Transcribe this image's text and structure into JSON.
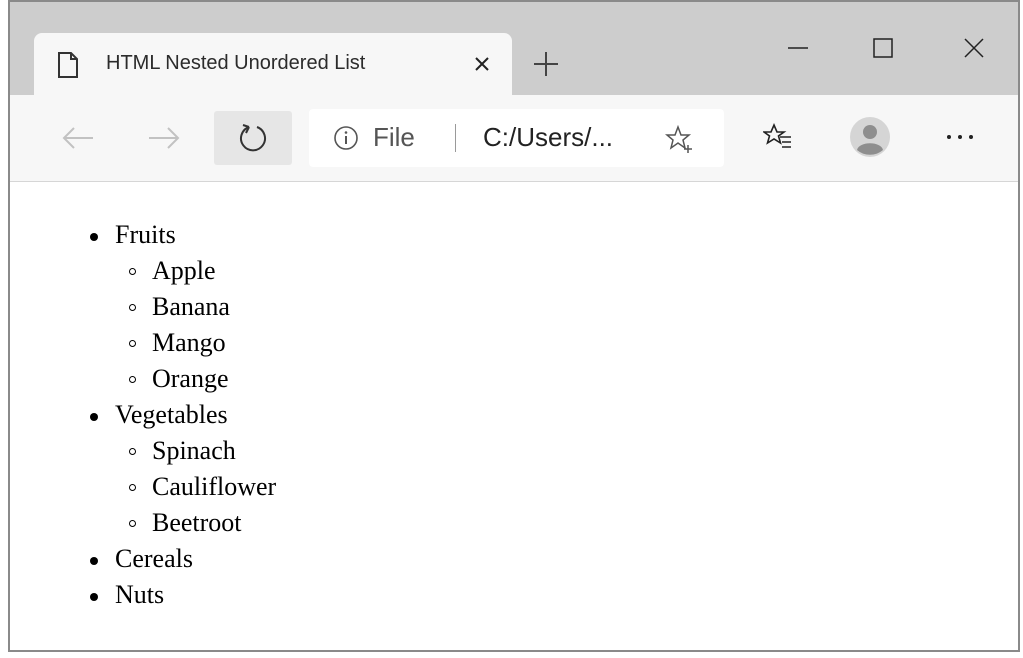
{
  "tab": {
    "title": "HTML Nested Unordered List",
    "icon": "page-icon"
  },
  "toolbar": {
    "address_prefix": "File",
    "url": "C:/Users/..."
  },
  "page": {
    "list": [
      {
        "label": "Fruits",
        "children": [
          "Apple",
          "Banana",
          "Mango",
          "Orange"
        ]
      },
      {
        "label": "Vegetables",
        "children": [
          "Spinach",
          "Cauliflower",
          "Beetroot"
        ]
      },
      {
        "label": "Cereals",
        "children": []
      },
      {
        "label": "Nuts",
        "children": []
      }
    ]
  },
  "colors": {
    "tabstrip_bg": "#cdcdcd",
    "toolbar_bg": "#f7f7f7",
    "content_bg": "#ffffff"
  }
}
